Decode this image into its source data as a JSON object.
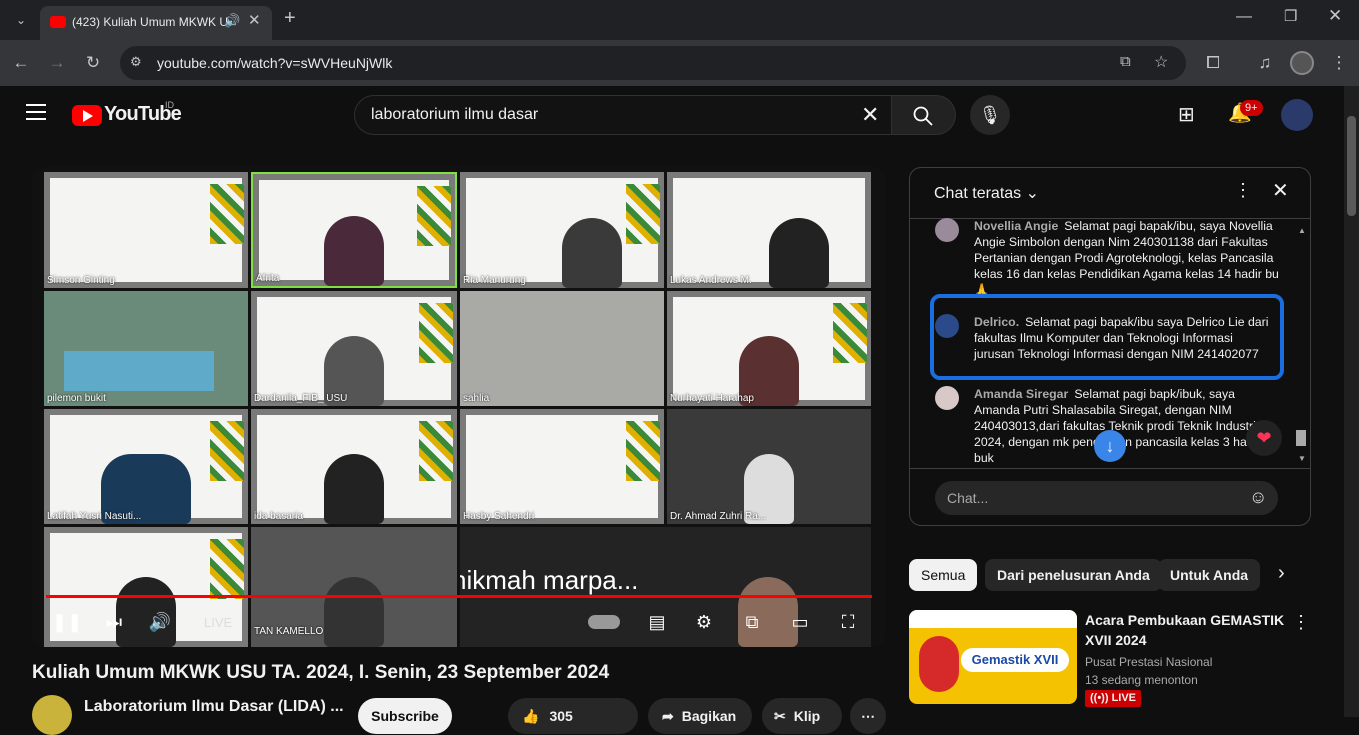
{
  "browser": {
    "tab_title": "(423) Kuliah Umum MKWK U",
    "url": "youtube.com/watch?v=sWVHeuNjWlk"
  },
  "header": {
    "logo_text": "YouTube",
    "region": "ID",
    "search_value": "laboratorium ilmu dasar",
    "notif_count": "9+"
  },
  "video": {
    "participants": [
      "Simson Ginting",
      "Afrita",
      "Ria Manurung",
      "Lukas Andrews M.",
      "pilemon bukit",
      "Dardanila_FIB_ USU",
      "sahlia",
      "Nurhayati Harahap",
      "Latifah Yusri Nasuti...",
      "ida basaria",
      "Hasby Sahendri",
      "Dr. Ahmad Zuhri Ra...",
      "",
      "TAN KAMELLO",
      "nikmah marpa..."
    ],
    "live_label": "LIVE",
    "progress": 1.0
  },
  "title": "Kuliah Umum MKWK USU TA. 2024, I. Senin, 23 September 2024",
  "channel": {
    "name": "Laboratorium Ilmu Dasar (LIDA) ...",
    "subscribe_label": "Subscribe",
    "likes": "305",
    "share_label": "Bagikan",
    "clip_label": "Klip"
  },
  "chat": {
    "header": "Chat teratas",
    "messages": [
      {
        "author": "Novellia Angie",
        "text": "Selamat pagi bapak/ibu, saya Novellia Angie Simbolon dengan Nim 240301138 dari Fakultas Pertanian dengan Prodi Agroteknologi, kelas Pancasila kelas 16 dan kelas Pendidikan Agama kelas 14 hadir bu 🙏"
      },
      {
        "author": "Delrico.",
        "text": "Selamat pagi bapak/ibu saya Delrico Lie dari fakultas Ilmu Komputer dan Teknologi Informasi jurusan Teknologi Informasi dengan NIM 241402077"
      },
      {
        "author": "Amanda Siregar",
        "text": "Selamat pagi bapk/ibuk, saya Amanda Putri Shalasabila Siregat, dengan NIM 240403013,dari fakultas Teknik prodi Teknik Industri 2024, dengan mk pendidikan pancasila kelas 3 hadir buk"
      }
    ],
    "input_placeholder": "Chat..."
  },
  "chips": [
    "Semua",
    "Dari penelusuran Anda",
    "Untuk Anda"
  ],
  "recommendation": {
    "title": "Acara Pembukaan GEMASTIK XVII 2024",
    "channel": "Pusat Prestasi Nasional",
    "viewers": "13 sedang menonton",
    "badge": "LIVE",
    "thumb_text": "Gemastik XVII"
  }
}
